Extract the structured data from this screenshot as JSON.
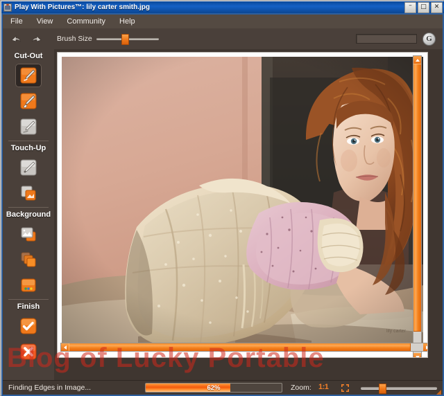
{
  "window": {
    "title": "Play With Pictures™: lily carter smith.jpg",
    "app_icon": "camera-icon",
    "controls": {
      "minimize": "–",
      "maximize": "□",
      "close": "✕"
    }
  },
  "menubar": {
    "items": [
      {
        "label": "File"
      },
      {
        "label": "View"
      },
      {
        "label": "Community"
      },
      {
        "label": "Help"
      }
    ]
  },
  "toolbar": {
    "undo_icon": "undo-arrow-icon",
    "redo_icon": "redo-arrow-icon",
    "brush_size_label": "Brush Size",
    "brush_size_percent": 45,
    "search_value": "",
    "search_placeholder": "",
    "community_button_label": "G"
  },
  "sidebar": {
    "groups": [
      {
        "title": "Cut-Out",
        "tools": [
          {
            "name": "cut-out-brush-tool",
            "icon": "brush-orange-icon",
            "selected": true
          },
          {
            "name": "cut-out-erase-tool",
            "icon": "brush-erase-orange-icon",
            "selected": false
          },
          {
            "name": "cut-out-smart-tool",
            "icon": "brush-grey-icon",
            "selected": false
          }
        ]
      },
      {
        "title": "Touch-Up",
        "tools": [
          {
            "name": "touch-up-brush-tool",
            "icon": "brush-grey-icon",
            "selected": false
          },
          {
            "name": "touch-up-layers-tool",
            "icon": "layers-orange-icon",
            "selected": false
          }
        ]
      },
      {
        "title": "Background",
        "tools": [
          {
            "name": "background-image-tool",
            "icon": "picture-icon",
            "selected": false
          },
          {
            "name": "background-stack-tool",
            "icon": "stack-squares-icon",
            "selected": false
          },
          {
            "name": "background-color-tool",
            "icon": "color-swatch-icon",
            "selected": false
          }
        ]
      },
      {
        "title": "Finish",
        "tools": [
          {
            "name": "finish-accept-button",
            "icon": "checkmark-icon",
            "selected": false
          },
          {
            "name": "finish-cancel-button",
            "icon": "cross-icon",
            "selected": false
          }
        ]
      }
    ]
  },
  "canvas": {
    "image_alt": "Portrait photograph of a woman with long curly red hair wearing a pink floral sleeve, beside cream lace fabric against a pink wall",
    "vscroll": {
      "up": "▲",
      "down": "▼",
      "thumb_percent": 92
    },
    "hscroll": {
      "left": "◀",
      "right": "▶",
      "thumb_percent": 96
    }
  },
  "statusbar": {
    "status_text": "Finding Edges in Image...",
    "progress_percent": 62,
    "progress_label": "62%",
    "zoom_label": "Zoom:",
    "zoom_ratio": "1:1",
    "fit_icon": "fit-to-screen-icon",
    "zoom_slider_percent": 26
  },
  "watermark": {
    "text": "Blog of Lucky Portable"
  },
  "colors": {
    "accent_orange": "#f2802a",
    "panel_brown": "#4a403a",
    "titlebar_blue": "#1560c4",
    "watermark_red": "#d0281c"
  }
}
